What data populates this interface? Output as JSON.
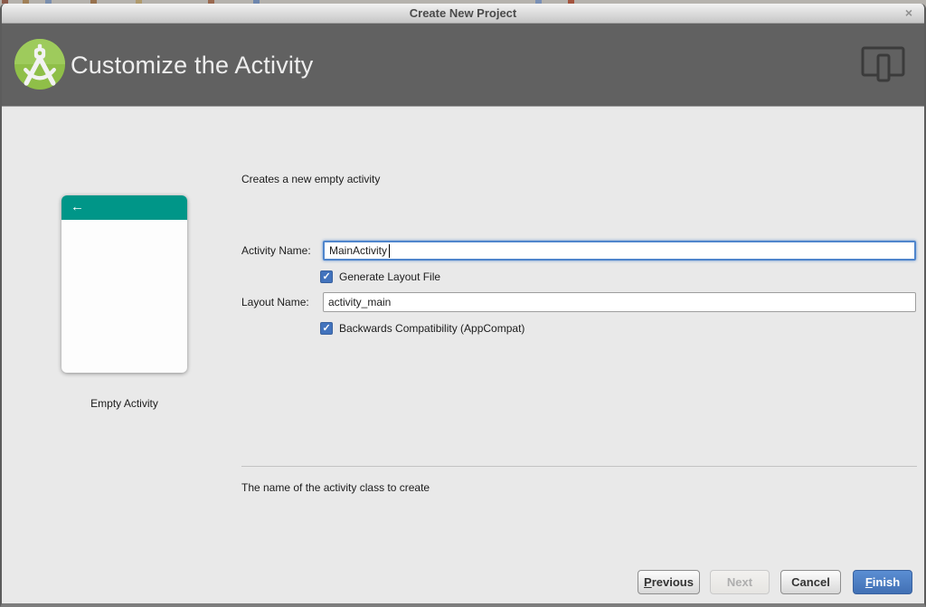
{
  "window": {
    "title": "Create New Project",
    "close_glyph": "×"
  },
  "header": {
    "title": "Customize the Activity",
    "logo": "android-studio-logo",
    "right_icon": "phone-tablet-icon",
    "background_color": "#616161"
  },
  "content": {
    "description": "Creates a new empty activity",
    "template": {
      "name": "Empty Activity",
      "back_glyph": "←",
      "accent_color": "#009688"
    },
    "form": {
      "activity_name": {
        "label": "Activity Name:",
        "value": "MainActivity",
        "focused": true
      },
      "generate_layout": {
        "label": "Generate Layout File",
        "checked": true
      },
      "layout_name": {
        "label": "Layout Name:",
        "value": "activity_main",
        "focused": false
      },
      "backwards_compat": {
        "label": "Backwards Compatibility (AppCompat)",
        "checked": true
      }
    },
    "hint": "The name of the activity class to create"
  },
  "footer": {
    "buttons": [
      {
        "label": "Previous",
        "enabled": true,
        "primary": false,
        "mnemonic": "P"
      },
      {
        "label": "Next",
        "enabled": false,
        "primary": false
      },
      {
        "label": "Cancel",
        "enabled": true,
        "primary": false
      },
      {
        "label": "Finish",
        "enabled": true,
        "primary": true,
        "mnemonic": "F"
      }
    ]
  },
  "colors": {
    "checkbox_blue": "#4273bd",
    "finish_button_blue": "#4b7dc3",
    "focus_ring_blue": "#5489cf",
    "teal_accent": "#009688",
    "header_gray": "#616161",
    "content_gray": "#e9e9e9"
  }
}
